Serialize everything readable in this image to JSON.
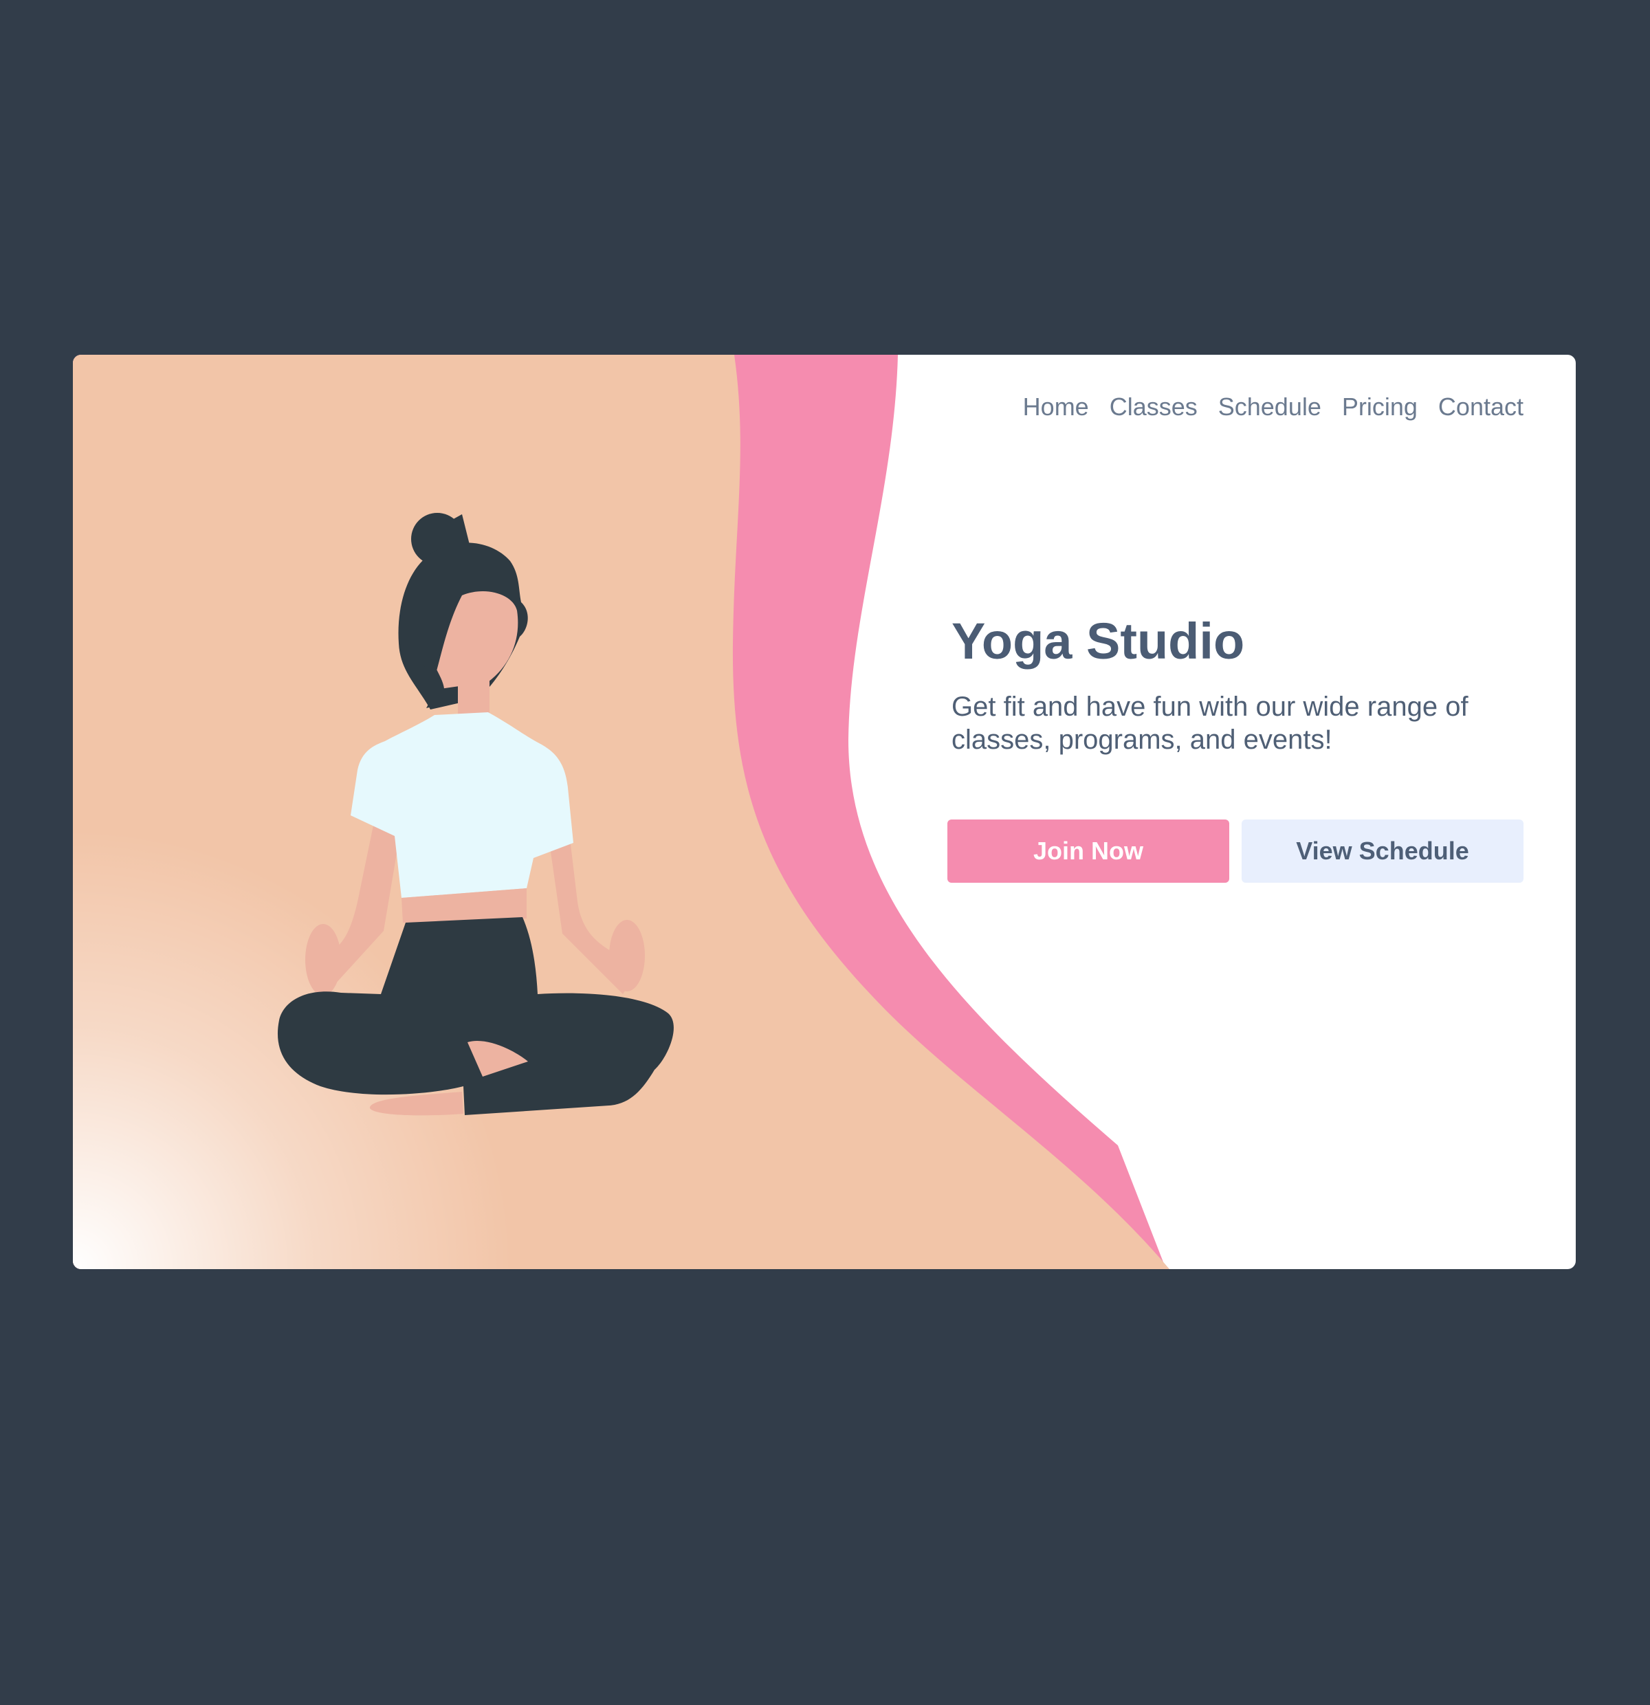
{
  "nav": {
    "items": [
      "Home",
      "Classes",
      "Schedule",
      "Pricing",
      "Contact"
    ]
  },
  "hero": {
    "title": "Yoga Studio",
    "subtitle": "Get fit and have fun with our wide range of classes, programs, and events!",
    "primary_button": "Join Now",
    "secondary_button": "View Schedule"
  },
  "colors": {
    "page_background": "#323d4a",
    "card_background": "#ffffff",
    "peach": "#f2c5a8",
    "pink_accent": "#f58caf",
    "title_text": "#4b5c74",
    "nav_text": "#6b7a8f",
    "secondary_button_bg": "#e8effd",
    "figure_dark": "#2e3a42",
    "skin": "#edb3a1",
    "shirt": "#e6f9fd"
  },
  "illustration": {
    "subject": "woman-meditating-icon"
  }
}
